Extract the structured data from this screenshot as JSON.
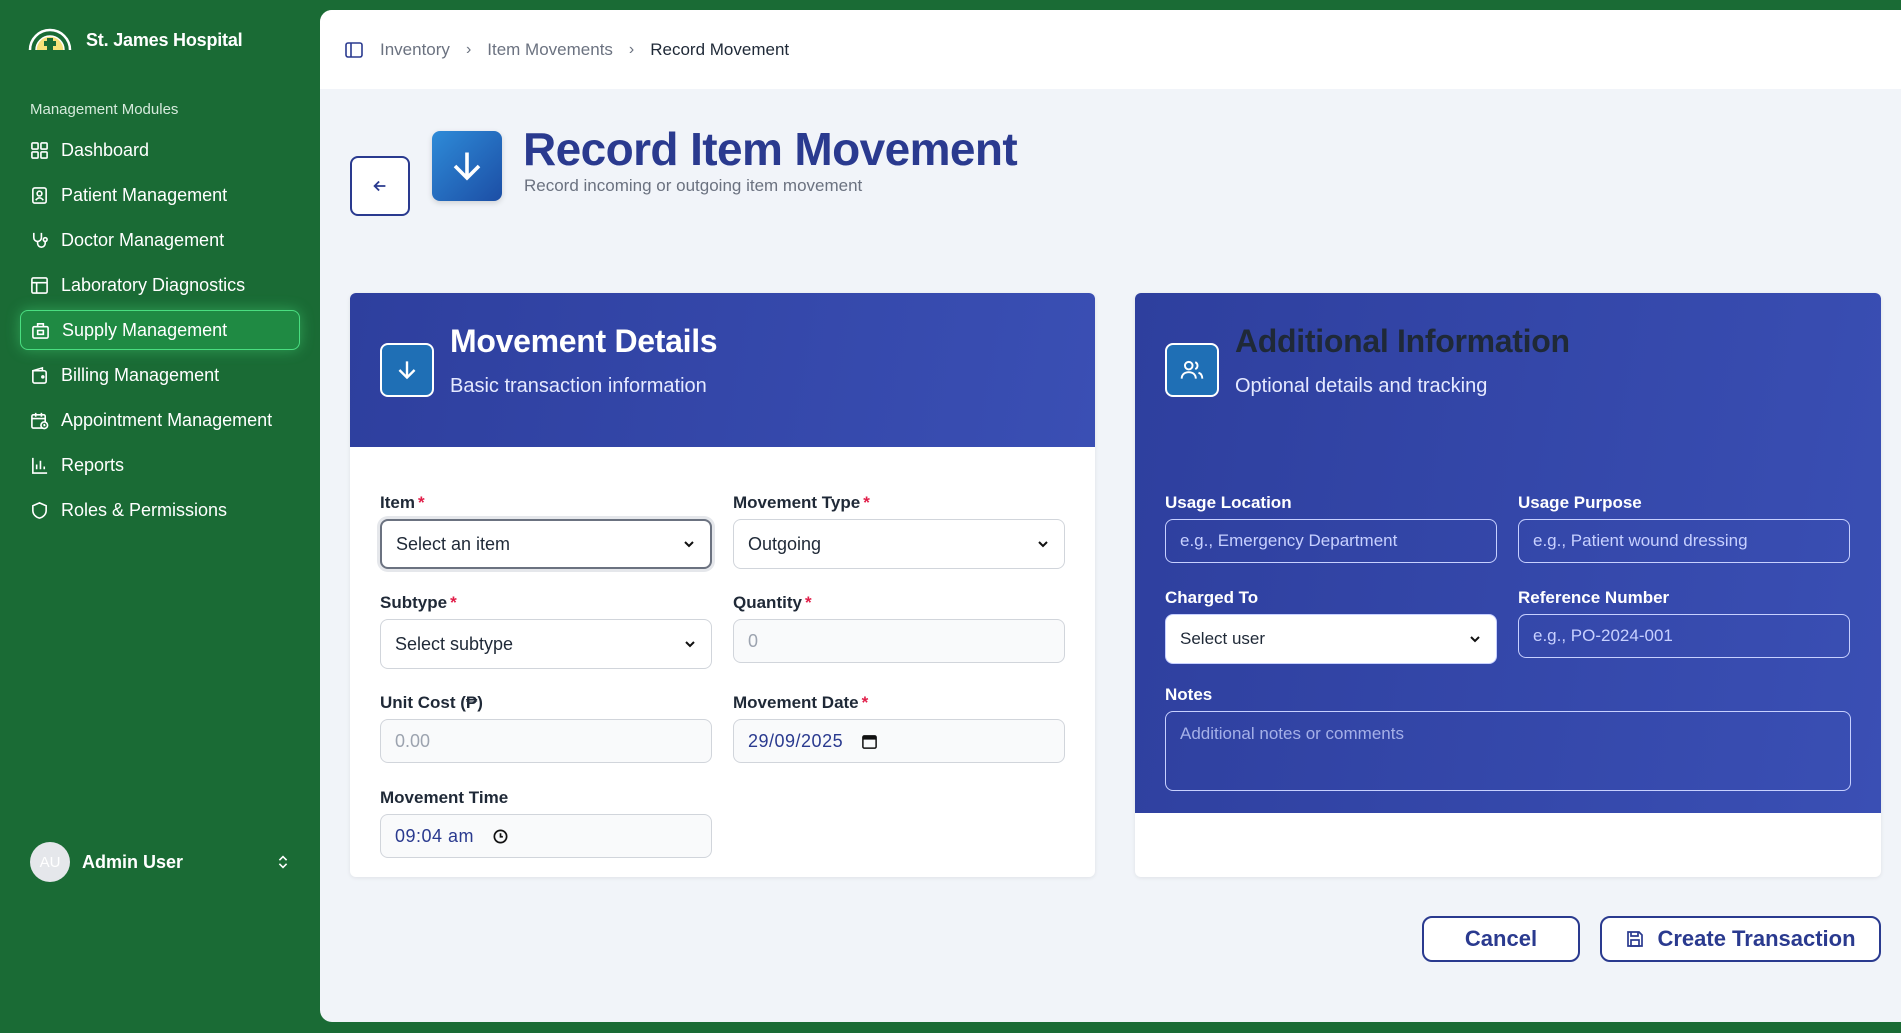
{
  "brand": {
    "name": "St. James Hospital"
  },
  "sidebar": {
    "section_label": "Management Modules",
    "items": [
      {
        "label": "Dashboard",
        "icon": "dashboard-icon"
      },
      {
        "label": "Patient Management",
        "icon": "patient-icon"
      },
      {
        "label": "Doctor Management",
        "icon": "stethoscope-icon"
      },
      {
        "label": "Laboratory Diagnostics",
        "icon": "table-icon"
      },
      {
        "label": "Supply Management",
        "icon": "supply-icon",
        "active": true
      },
      {
        "label": "Billing Management",
        "icon": "wallet-icon"
      },
      {
        "label": "Appointment Management",
        "icon": "calendar-icon"
      },
      {
        "label": "Reports",
        "icon": "bar-chart-icon"
      },
      {
        "label": "Roles & Permissions",
        "icon": "shield-icon"
      }
    ],
    "user": {
      "initials": "AU",
      "name": "Admin User"
    }
  },
  "breadcrumb": [
    "Inventory",
    "Item Movements",
    "Record Movement"
  ],
  "page": {
    "title": "Record Item Movement",
    "subtitle": "Record incoming or outgoing item movement"
  },
  "movement_details": {
    "title": "Movement Details",
    "subtitle": "Basic transaction information",
    "item": {
      "label": "Item",
      "value": "Select an item"
    },
    "movement_type": {
      "label": "Movement Type",
      "value": "Outgoing"
    },
    "subtype": {
      "label": "Subtype",
      "value": "Select subtype"
    },
    "quantity": {
      "label": "Quantity",
      "placeholder": "0"
    },
    "unit_cost": {
      "label": "Unit Cost (₱)",
      "placeholder": "0.00"
    },
    "movement_date": {
      "label": "Movement Date",
      "value": "29/09/2025"
    },
    "movement_time": {
      "label": "Movement Time",
      "value": "09:04 am"
    }
  },
  "additional_info": {
    "title": "Additional Information",
    "subtitle": "Optional details and tracking",
    "usage_location": {
      "label": "Usage Location",
      "placeholder": "e.g., Emergency Department"
    },
    "usage_purpose": {
      "label": "Usage Purpose",
      "placeholder": "e.g., Patient wound dressing"
    },
    "charged_to": {
      "label": "Charged To",
      "value": "Select user"
    },
    "reference_number": {
      "label": "Reference Number",
      "placeholder": "e.g., PO-2024-001"
    },
    "notes": {
      "label": "Notes",
      "placeholder": "Additional notes or comments"
    }
  },
  "actions": {
    "cancel": "Cancel",
    "create": "Create Transaction"
  },
  "colors": {
    "sidebar": "#1a6b35",
    "primary": "#2a3a8f",
    "required": "#e11d48"
  }
}
